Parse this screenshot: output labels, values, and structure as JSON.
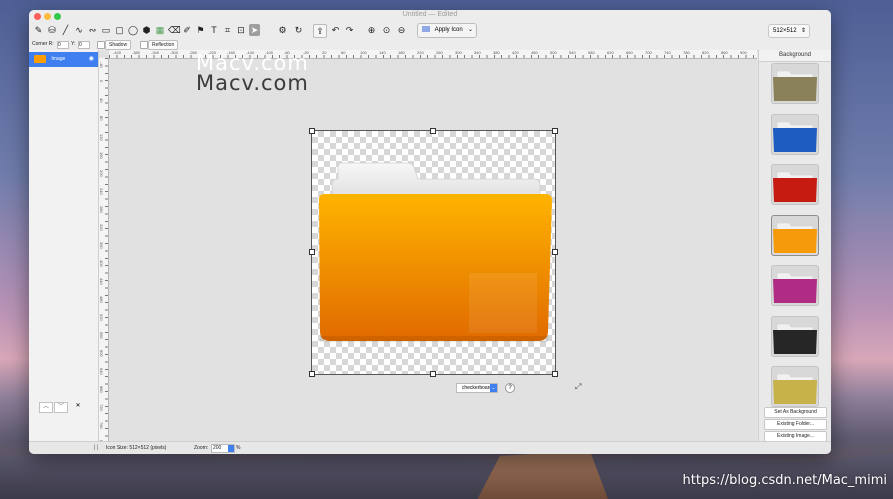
{
  "window": {
    "title": "Untitled — Edited",
    "title_color": "#9b9b9b"
  },
  "toolbar": {
    "tools": [
      {
        "name": "pencil-icon",
        "glyph": "✎"
      },
      {
        "name": "paint-bucket-icon",
        "glyph": "⛁"
      },
      {
        "name": "line-icon",
        "glyph": "╱"
      },
      {
        "name": "curve-icon",
        "glyph": "∿"
      },
      {
        "name": "bezier-icon",
        "glyph": "∾"
      },
      {
        "name": "rectangle-icon",
        "glyph": "▭"
      },
      {
        "name": "rounded-rectangle-icon",
        "glyph": "▢"
      },
      {
        "name": "ellipse-icon",
        "glyph": "◯"
      },
      {
        "name": "hexagon-icon",
        "glyph": "⬢"
      },
      {
        "name": "gradient-icon",
        "glyph": "▦"
      },
      {
        "name": "eraser-icon",
        "glyph": "⌫"
      },
      {
        "name": "brush-icon",
        "glyph": "✐"
      },
      {
        "name": "stamp-icon",
        "glyph": "⚑"
      },
      {
        "name": "text-icon",
        "glyph": "T"
      },
      {
        "name": "crop-icon",
        "glyph": "⌗"
      },
      {
        "name": "magnify-select-icon",
        "glyph": "⊡"
      },
      {
        "name": "arrow-select-icon",
        "glyph": "➤"
      }
    ],
    "gear": "⚙",
    "refresh": "↻",
    "undo": "↶",
    "redo": "↷",
    "zoom_in": "⊕",
    "zoom_fit": "⊙",
    "zoom_out": "⊖",
    "apply_icon_label": "Apply Icon",
    "size_select": "512×512"
  },
  "options": {
    "corner_r_label": "Corner R:",
    "corner_r_value": "0",
    "y_label": "Y:",
    "y_value": "0",
    "shadow_label": "Shadow",
    "reflection_label": "Reflection"
  },
  "layers": {
    "items": [
      {
        "label": "Image"
      }
    ],
    "nav_up": "︿",
    "nav_down": "﹀",
    "nav_delete": "✕"
  },
  "ruler": {
    "h_labels": [
      "-420",
      "-380",
      "-340",
      "-300",
      "-260",
      "-220",
      "-180",
      "-140",
      "-100",
      "-60",
      "-20",
      "20",
      "60",
      "100",
      "140",
      "180",
      "220",
      "260",
      "300",
      "340",
      "380",
      "420",
      "460",
      "500",
      "540",
      "580",
      "620",
      "660",
      "700",
      "740",
      "780",
      "820",
      "860",
      "900"
    ],
    "v_labels": [
      "-40",
      "0",
      "40",
      "80",
      "120",
      "160",
      "200",
      "240",
      "280",
      "320",
      "360",
      "400",
      "440",
      "480",
      "520",
      "560",
      "600",
      "640",
      "680",
      "720",
      "760",
      "800"
    ]
  },
  "canvas": {
    "background_mode": "checkerboard",
    "help": "?"
  },
  "sidebar": {
    "header": "Background",
    "thumbs": [
      {
        "name": "folder-thumb-olive",
        "color": "#8a8059"
      },
      {
        "name": "folder-thumb-blue",
        "color": "#1f5cc2"
      },
      {
        "name": "folder-thumb-red",
        "color": "#c51b10"
      },
      {
        "name": "folder-thumb-orange",
        "color": "#f59a0b"
      },
      {
        "name": "folder-thumb-magenta",
        "color": "#b02c84"
      },
      {
        "name": "folder-thumb-black",
        "color": "#262626"
      },
      {
        "name": "folder-thumb-gold",
        "color": "#c7b24a"
      }
    ],
    "set_background": "Set As Background",
    "existing_folder": "Existing Folder...",
    "existing_image": "Existing Image..."
  },
  "status": {
    "icon_size": "Icon Size: 512×512 (pixels)",
    "zoom_label": "Zoom:",
    "zoom_value": "200",
    "zoom_unit": "%"
  },
  "watermarks": {
    "top": "Macv.com",
    "bottom": "Macv.com",
    "footer": "https://blog.csdn.net/Mac_mimi"
  },
  "colors": {
    "folder_orange": "#ff9d00",
    "folder_orange_dark": "#e06e00",
    "selection": "#3f7ff0"
  }
}
